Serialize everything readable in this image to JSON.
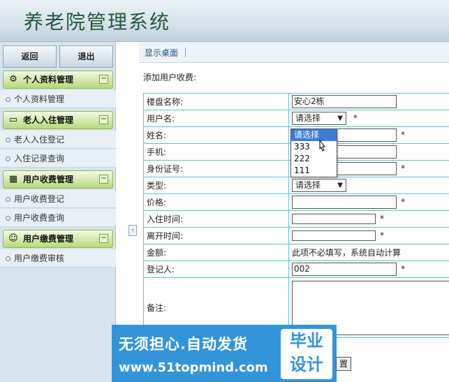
{
  "header": {
    "title": "养老院管理系统"
  },
  "sidebar": {
    "back_label": "返回",
    "logout_label": "退出",
    "sections": [
      {
        "label": "个人资料管理",
        "icon": "gear-icon",
        "items": [
          "个人资料管理"
        ]
      },
      {
        "label": "老人入住管理",
        "icon": "monitor-icon",
        "items": [
          "老人入住登记",
          "入住记录查询"
        ]
      },
      {
        "label": "用户收费管理",
        "icon": "calendar-icon",
        "items": [
          "用户收费登记",
          "用户收费查询"
        ]
      },
      {
        "label": "用户缴费管理",
        "icon": "user-icon",
        "items": [
          "用户缴费审核"
        ]
      }
    ],
    "collapse_glyph": "⊟"
  },
  "tabs": {
    "home": "显示桌面"
  },
  "form": {
    "heading": "添加用户收费:",
    "star": "*",
    "fields": {
      "building": {
        "label": "楼盘名称:",
        "value": "安心2栋"
      },
      "username": {
        "label": "用户名:",
        "value": "请选择"
      },
      "name": {
        "label": "姓名:",
        "value": ""
      },
      "phone": {
        "label": "手机:",
        "value": ""
      },
      "idcard": {
        "label": "身份证号:",
        "value": ""
      },
      "type": {
        "label": "类型:",
        "value": "请选择"
      },
      "price": {
        "label": "价格:",
        "value": ""
      },
      "checkin": {
        "label": "入住时间:",
        "value": ""
      },
      "checkout": {
        "label": "离开时间:",
        "value": ""
      },
      "amount": {
        "label": "金额:",
        "value": "此项不必填写，系统自动计算"
      },
      "registrar": {
        "label": "登记人:",
        "value": "002"
      },
      "remark": {
        "label": "备注:",
        "value": ""
      }
    },
    "dropdown_options": [
      "请选择",
      "333",
      "222",
      "111"
    ],
    "reset_label": "置"
  },
  "watermark": {
    "line1": "无须担心.自动发货",
    "line2": "www.51topmind.com",
    "badge1": "毕业",
    "badge2": "设计"
  }
}
